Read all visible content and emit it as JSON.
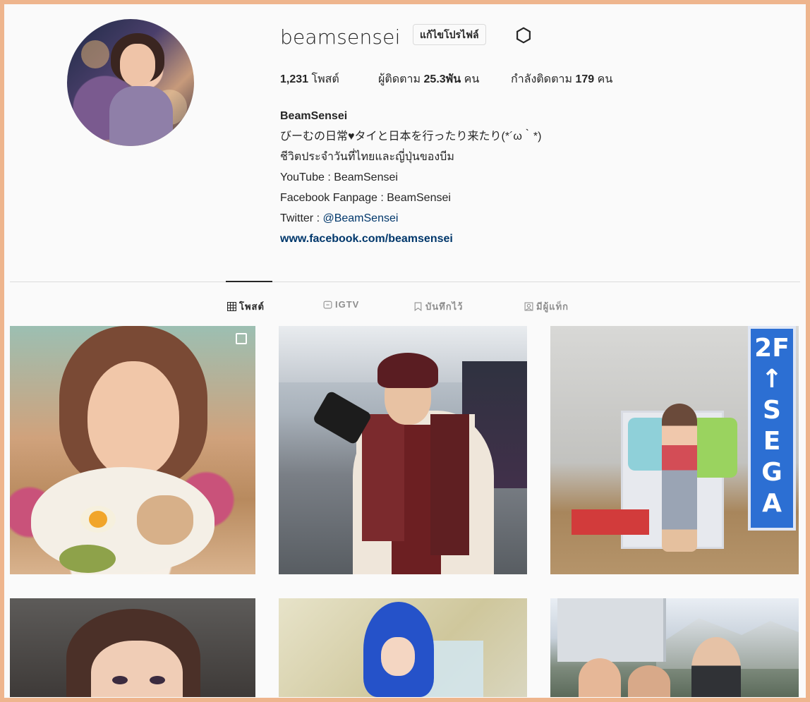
{
  "profile": {
    "username": "beamsensei",
    "edit_label": "แก้ไขโปรไฟล์",
    "posts_count": "1,231",
    "posts_label": "โพสต์",
    "followers_prefix": "ผู้ติดตาม",
    "followers_count": "25.3พัน",
    "followers_suffix": "คน",
    "following_prefix": "กำลังติดตาม",
    "following_count": "179",
    "following_suffix": "คน"
  },
  "bio": {
    "name": "BeamSensei",
    "line1": "びーむの日常♥タイと日本を行ったり来たり(*´ω｀*)",
    "line2": "ชีวิตประจำวันที่ไทยและญี่ปุ่นของบีม",
    "line3": "YouTube : BeamSensei",
    "line4": "Facebook Fanpage : BeamSensei",
    "twitter_prefix": "Twitter : ",
    "twitter_handle": "@BeamSensei",
    "website": "www.facebook.com/beamsensei"
  },
  "tabs": [
    {
      "label": "โพสต์",
      "icon": "grid-icon",
      "active": true
    },
    {
      "label": "IGTV",
      "icon": "igtv-icon",
      "active": false
    },
    {
      "label": "บันทึกไว้",
      "icon": "bookmark-icon",
      "active": false
    },
    {
      "label": "มีผู้แท็ก",
      "icon": "tagged-icon",
      "active": false
    }
  ],
  "post_overlay": {
    "sign_text": "2F\n↑\nSEGA"
  },
  "colors": {
    "frame": "#eeb58d",
    "link": "#00376b",
    "text": "#262626",
    "muted": "#8e8e8e"
  }
}
